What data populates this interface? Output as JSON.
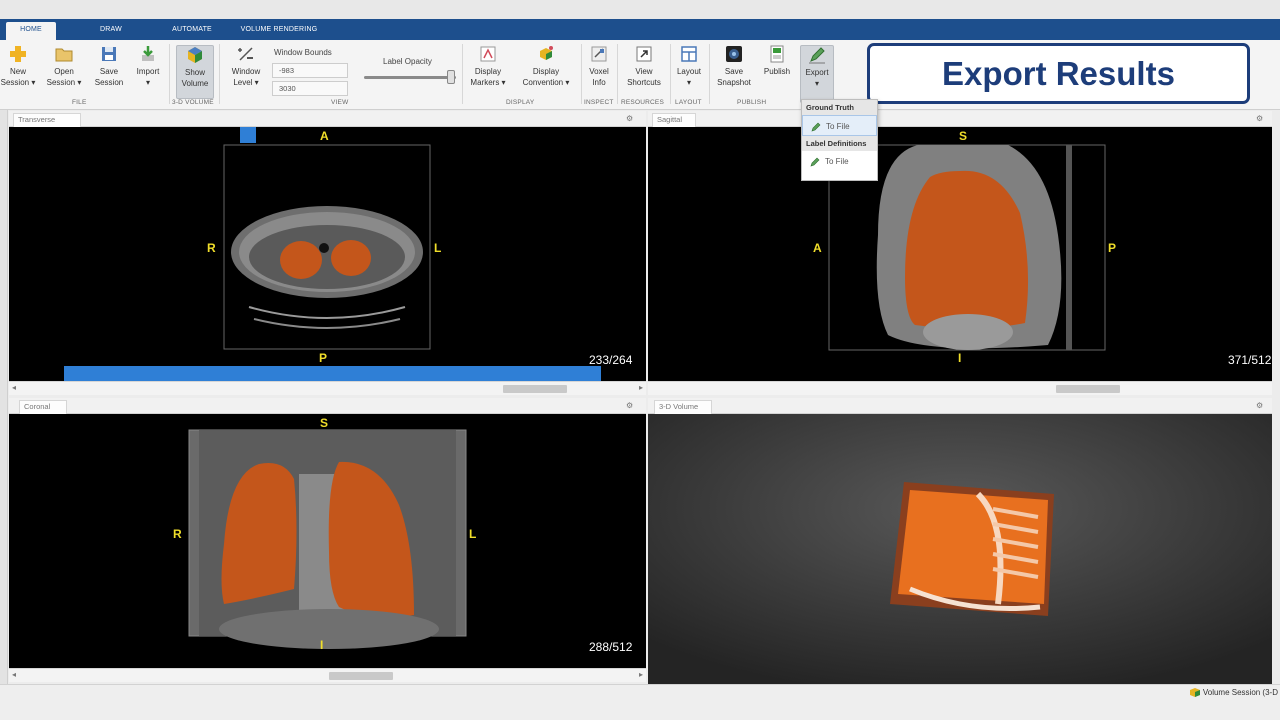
{
  "tabs": [
    {
      "label": "HOME",
      "active": true
    },
    {
      "label": "DRAW",
      "active": false
    },
    {
      "label": "AUTOMATE",
      "active": false
    },
    {
      "label": "VOLUME RENDERING",
      "active": false
    }
  ],
  "toolstrip": {
    "file": {
      "new_label": "New",
      "new_sub": "Session ▾",
      "open_label": "Open",
      "open_sub": "Session ▾",
      "save_label": "Save",
      "save_sub": "Session",
      "import_label": "Import",
      "import_sub": "▾",
      "section": "FILE"
    },
    "volume3d": {
      "show_label": "Show",
      "show_sub": "Volume",
      "section": "3-D VOLUME"
    },
    "view": {
      "window_label": "Window",
      "window_sub": "Level ▾",
      "window_bounds_title": "Window Bounds",
      "window_min": "-983",
      "window_max": "3030",
      "label_opacity_title": "Label Opacity",
      "section": "VIEW"
    },
    "display": {
      "markers_label": "Display",
      "markers_sub": "Markers ▾",
      "convention_label": "Display",
      "convention_sub": "Convention ▾",
      "section": "DISPLAY"
    },
    "inspect": {
      "voxel_label": "Voxel",
      "voxel_sub": "Info",
      "section": "INSPECT"
    },
    "resources": {
      "shortcuts_label": "View",
      "shortcuts_sub": "Shortcuts",
      "section": "RESOURCES"
    },
    "layout": {
      "layout_label": "Layout",
      "layout_sub": "▾",
      "section": "LAYOUT"
    },
    "publish": {
      "snapshot_label": "Save",
      "snapshot_sub": "Snapshot",
      "publish_label": "Publish",
      "section": "PUBLISH"
    },
    "export": {
      "label": "Export",
      "sub": "▾"
    }
  },
  "callout": {
    "text": "Export Results"
  },
  "export_menu": {
    "ground_truth_header": "Ground Truth",
    "ground_truth_item": "To File",
    "label_defs_header": "Label Definitions",
    "label_defs_item": "To File"
  },
  "panels": {
    "transverse": {
      "title": "Transverse",
      "top": "A",
      "bottom": "P",
      "left": "R",
      "right": "L",
      "slice": "233/264"
    },
    "sagittal": {
      "title": "Sagittal",
      "top": "S",
      "bottom": "I",
      "left": "A",
      "right": "P",
      "slice": "371/512"
    },
    "coronal": {
      "title": "Coronal",
      "top": "S",
      "bottom": "I",
      "left": "R",
      "right": "L",
      "slice": "288/512"
    },
    "volume3d": {
      "title": "3-D Volume"
    }
  },
  "status": {
    "text": "Volume Session (3-D"
  },
  "colors": {
    "tabbar": "#1d4f8d",
    "callout_text": "#1d3d7a",
    "orientation_label": "#f0de2a",
    "segmentation": "#c4561b"
  },
  "icons": [
    "new-session-icon",
    "open-session-icon",
    "save-session-icon",
    "import-icon",
    "show-volume-icon",
    "window-level-icon",
    "display-markers-icon",
    "display-convention-icon",
    "voxel-info-icon",
    "view-shortcuts-icon",
    "layout-icon",
    "save-snapshot-icon",
    "publish-icon",
    "export-icon",
    "gear-icon",
    "pen-icon",
    "volume-cube-icon"
  ]
}
